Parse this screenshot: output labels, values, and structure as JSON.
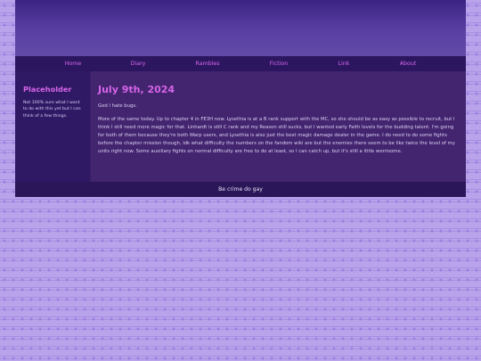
{
  "nav": {
    "items": [
      {
        "label": "Home"
      },
      {
        "label": "Diary"
      },
      {
        "label": "Rambles"
      },
      {
        "label": "Fiction"
      },
      {
        "label": "Link"
      },
      {
        "label": "About"
      }
    ]
  },
  "sidebar": {
    "title": "Placeholder",
    "text": "Not 100% sure what I want to do with this yet but I can think of a few things."
  },
  "post": {
    "date": "July 9th, 2024",
    "paragraphs": [
      "God I hate bugs.",
      "More of the same today. Up to chapter 4 in FE3H now. Lysethia is at a B rank support with the MC, so she should be as easy as possible to recruit, but I think I still need more magic for that. Linhardt is still C rank and my Reason still sucks, but I wanted early Faith levels for the budding talent. I'm going for both of them because they're both Warp users, and Lysethia is also just the best magic damage dealer in the game. I do need to do some fights before the chapter mission though, idk what difficulty the numbers on the fandom wiki are but the enemies there seem to be like twice the level of my units right now. Some auxiliary fights on normal difficulty are free to do at least, so I can catch up, but it's still a little worrisome."
    ]
  },
  "footer": {
    "text": "Be crime do gay"
  },
  "colors": {
    "accent": "#d765e8",
    "nav_bg": "#2c1660",
    "sidebar_bg": "#2f1964",
    "content_bg": "#42246f",
    "page_bg": "#b9a3ea"
  }
}
